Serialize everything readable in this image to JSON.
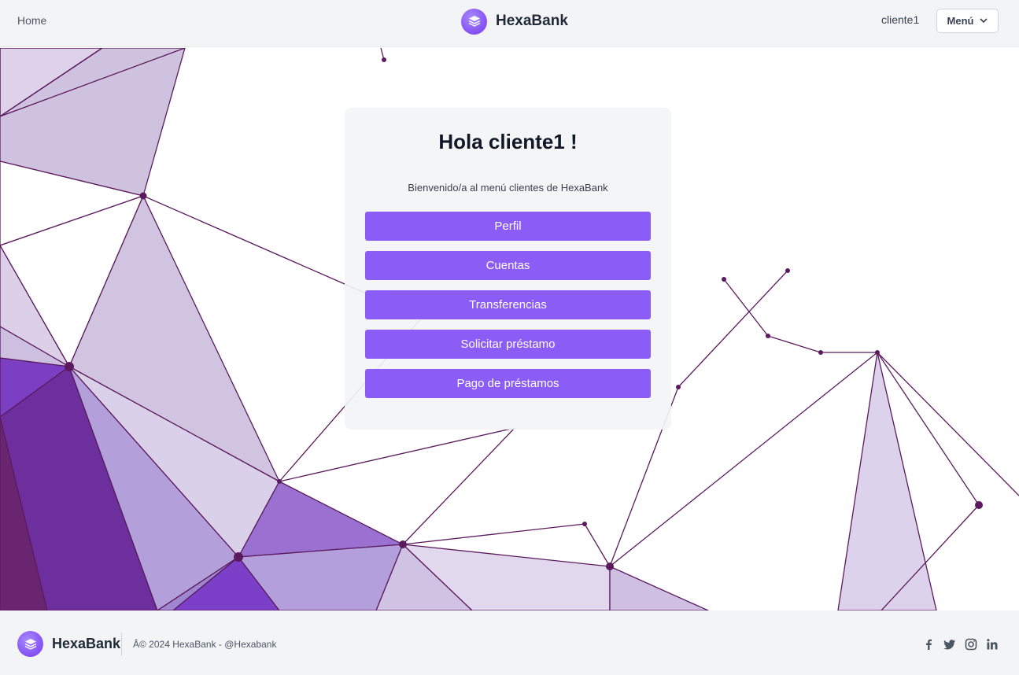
{
  "header": {
    "home_label": "Home",
    "brand_name": "HexaBank",
    "user_name": "cliente1",
    "menu_label": "Menú"
  },
  "main": {
    "greeting": "Hola cliente1 !",
    "subtitle": "Bienvenido/a al menú clientes de HexaBank",
    "actions": [
      {
        "label": "Perfil"
      },
      {
        "label": "Cuentas"
      },
      {
        "label": "Transferencias"
      },
      {
        "label": "Solicitar préstamo"
      },
      {
        "label": "Pago de préstamos"
      }
    ]
  },
  "footer": {
    "brand_name": "HexaBank",
    "copyright": "Â© 2024 HexaBank  - @Hexabank",
    "social_icons": [
      "facebook-icon",
      "twitter-icon",
      "instagram-icon",
      "linkedin-icon"
    ]
  },
  "colors": {
    "accent": "#8b5cf6",
    "header_bg": "#f3f4f6",
    "footer_bg": "#f3f4f6",
    "network_line": "#5b1a5e"
  }
}
